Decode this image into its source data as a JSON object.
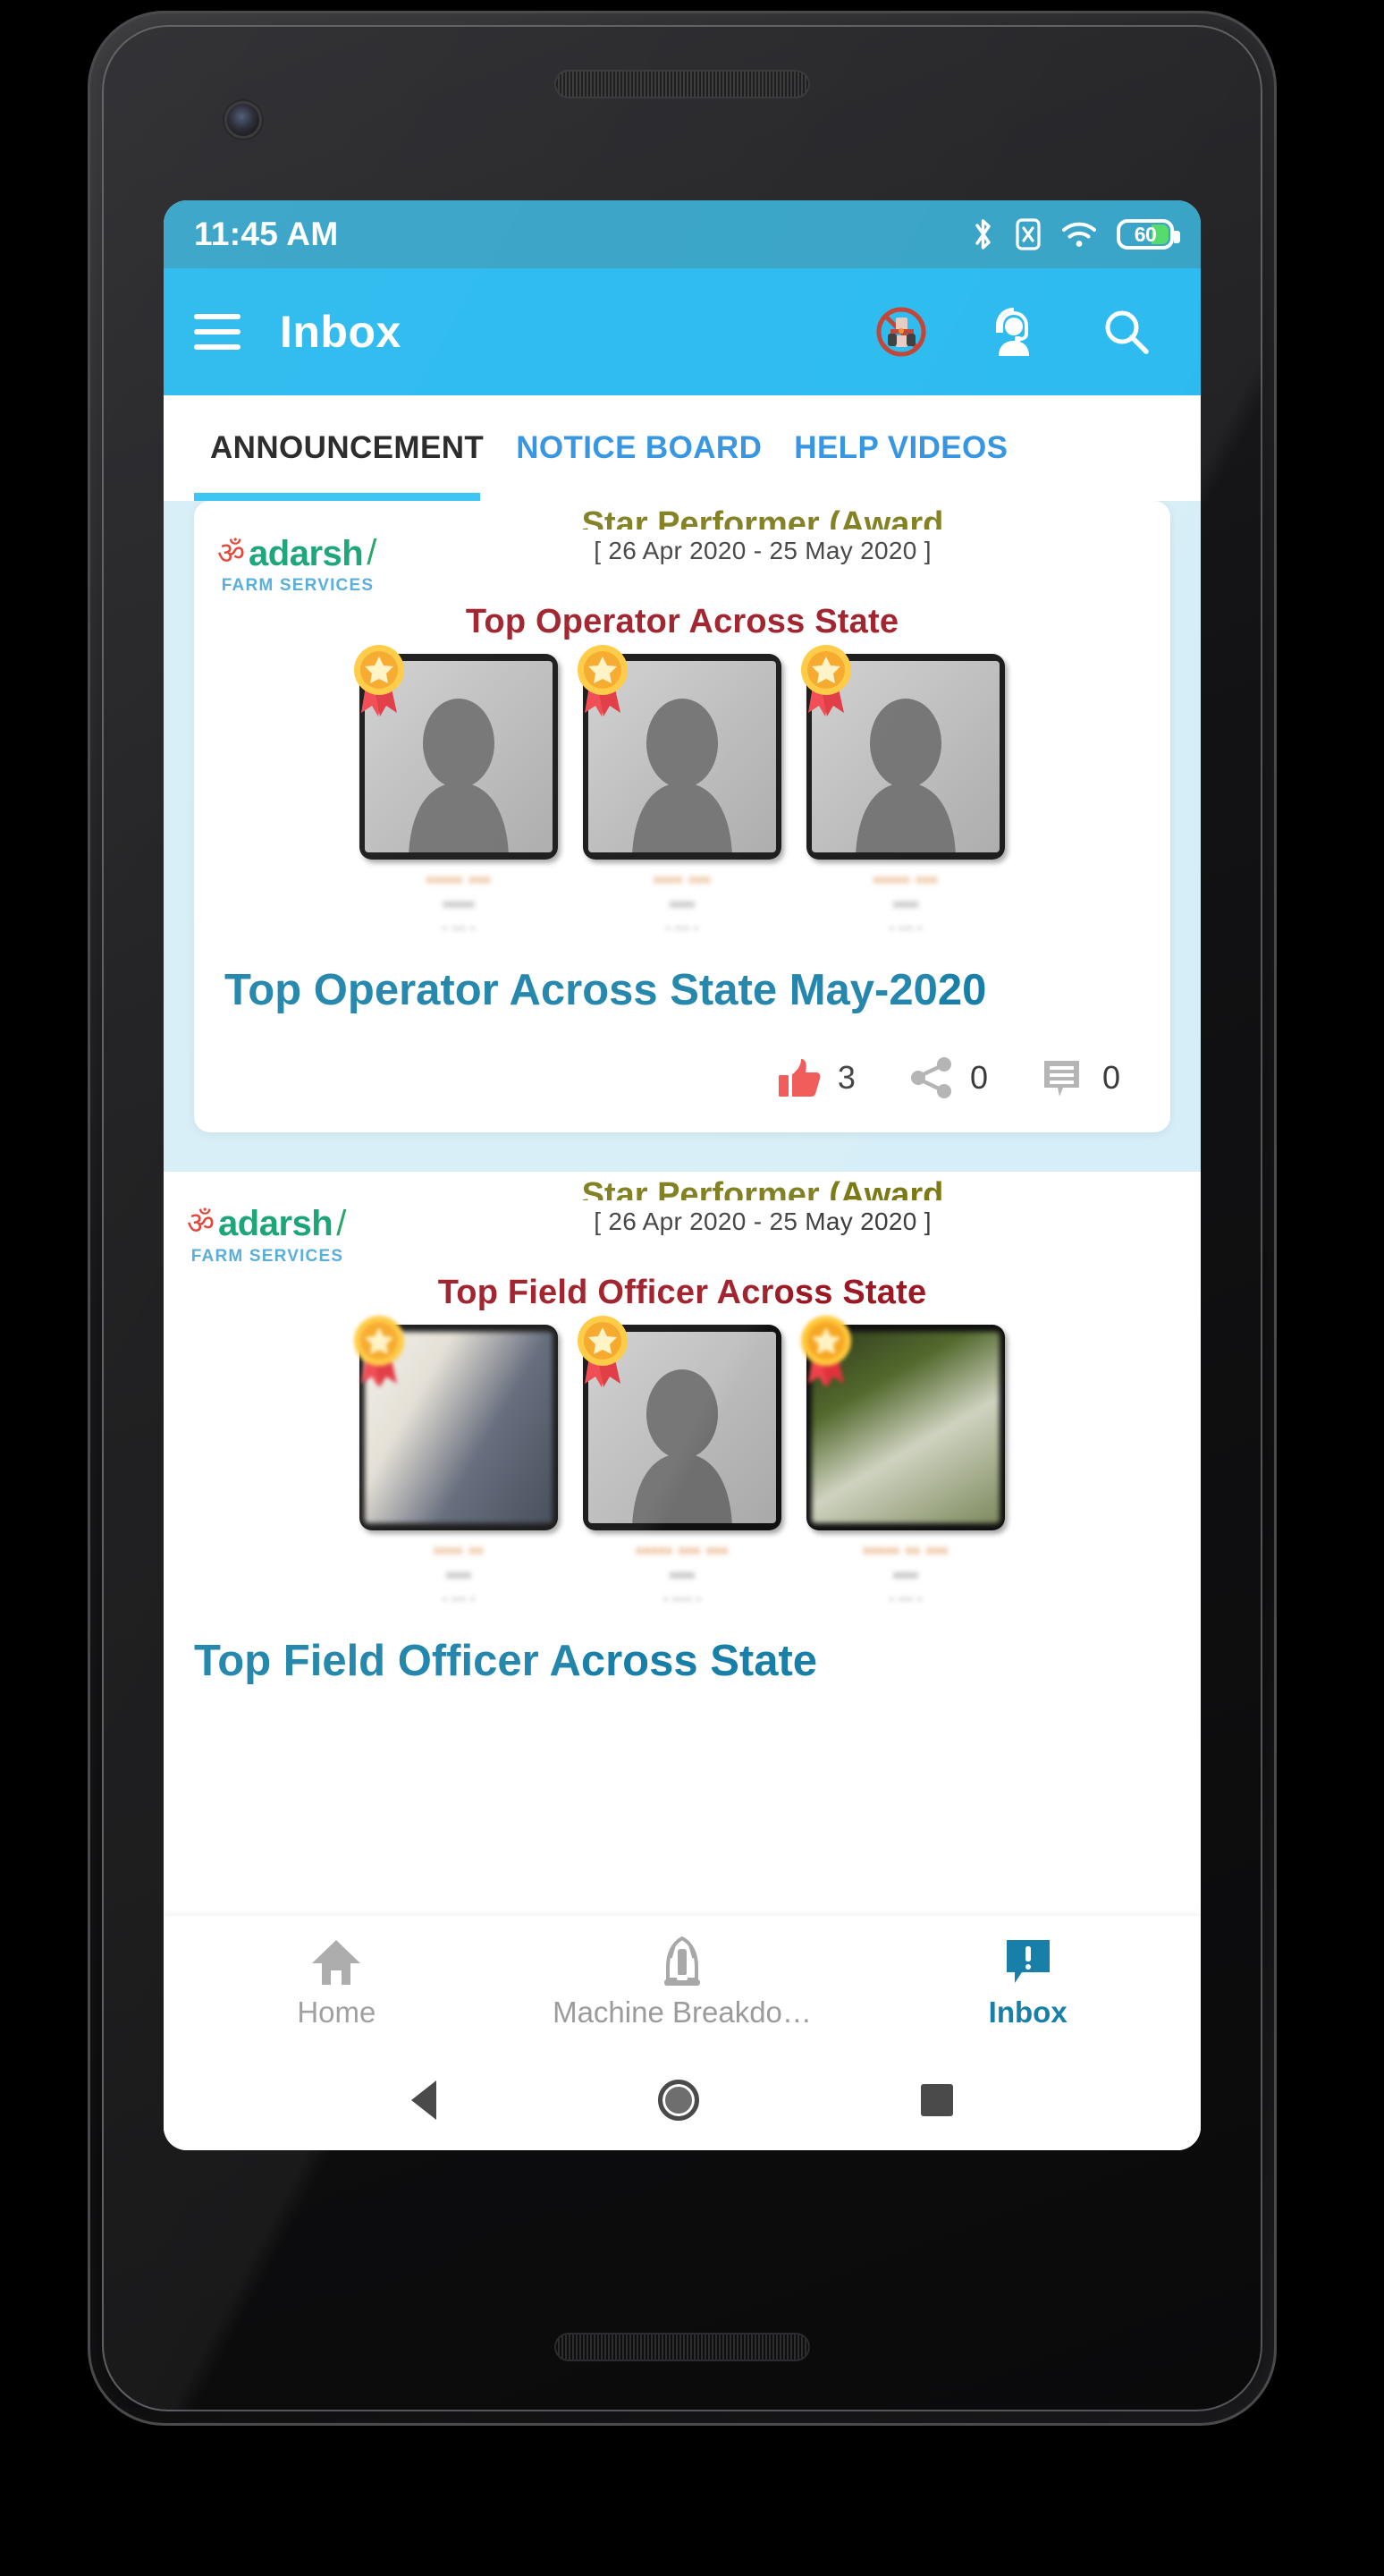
{
  "status_bar": {
    "time": "11:45 AM",
    "battery_level": "60",
    "icons": [
      "bluetooth-icon",
      "sim-no-signal-icon",
      "wifi-icon",
      "battery-icon"
    ]
  },
  "app_bar": {
    "menu_icon": "hamburger-menu-icon",
    "title": "Inbox",
    "actions": [
      {
        "name": "machine-breakdown-icon",
        "label": "Machine Breakdown"
      },
      {
        "name": "support-agent-icon",
        "label": "Support"
      },
      {
        "name": "search-icon",
        "label": "Search"
      }
    ]
  },
  "tabs": {
    "items": [
      {
        "label": "ANNOUNCEMENT",
        "active": true
      },
      {
        "label": "NOTICE BOARD",
        "active": false
      },
      {
        "label": "HELP VIDEOS",
        "active": false
      }
    ]
  },
  "brand": {
    "mark": "ॐ",
    "name": "adarsh",
    "slash": "/",
    "tagline": "FARM SERVICES"
  },
  "posts": [
    {
      "award_heading": "Star Performer (Award",
      "date_range": "[ 26 Apr 2020 - 25 May 2020 ]",
      "poster_subtitle": "Top Operator Across State",
      "winners": [
        {
          "name": "••••• •••",
          "sub": "•••••",
          "sub2": "•  ••• •",
          "image": "avatar-placeholder"
        },
        {
          "name": "•••• •••",
          "sub": "••••",
          "sub2": "•  ••• •",
          "image": "avatar-placeholder"
        },
        {
          "name": "••••• •••",
          "sub": "••••",
          "sub2": "•  ••• •",
          "image": "avatar-placeholder"
        }
      ],
      "title": "Top Operator Across State May-2020",
      "like_count": "3",
      "share_count": "0",
      "comment_count": "0",
      "liked": true
    },
    {
      "award_heading": "Star Performer (Award",
      "date_range": "[ 26 Apr 2020 - 25 May 2020 ]",
      "poster_subtitle": "Top Field Officer Across State",
      "winners": [
        {
          "name": "•••• ••",
          "sub": "••••",
          "sub2": "•  ••• •",
          "image": "photo-indoor"
        },
        {
          "name": "••••• ••• •••",
          "sub": "••••",
          "sub2": "•  •••• •",
          "image": "avatar-placeholder"
        },
        {
          "name": "••••• •• •••",
          "sub": "••••",
          "sub2": "•  ••• •",
          "image": "photo-outdoor"
        }
      ],
      "title": "Top Field Officer Across State",
      "like_count": "",
      "share_count": "",
      "comment_count": "",
      "liked": false
    }
  ],
  "bottom_nav": {
    "items": [
      {
        "label": "Home",
        "icon": "home-icon",
        "active": false
      },
      {
        "label": "Machine Breakdo…",
        "icon": "machine-icon",
        "active": false
      },
      {
        "label": "Inbox",
        "icon": "inbox-alert-icon",
        "active": true
      }
    ]
  },
  "system_nav": {
    "back": "back-button",
    "home": "home-button",
    "recents": "recents-button"
  },
  "colors": {
    "status_bar": "#2e9fc4",
    "app_bar": "#21b7ee",
    "tab_active_text": "#1c1c1c",
    "tab_inactive_text": "#2a8fe0",
    "tab_indicator": "#2ec1f2",
    "post_title": "#1880a8",
    "poster_subtitle": "#9c1823",
    "award_heading": "#7b7a17",
    "like_active": "#ef5350",
    "feed_background": "#d6eef7",
    "brand_green": "#0d9f6e",
    "brand_blue": "#4fa8d8"
  }
}
